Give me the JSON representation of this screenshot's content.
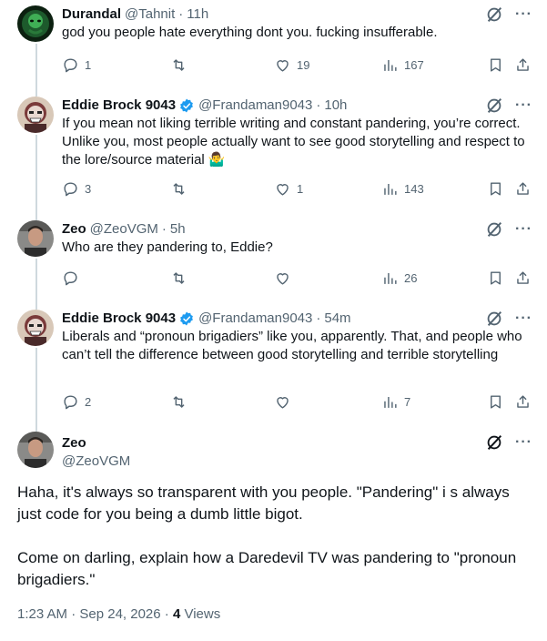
{
  "replies": [
    {
      "name": "Durandal",
      "handle": "@Tahnit",
      "time": "11h",
      "verified": false,
      "text": "god you people hate everything dont you. fucking insufferable.",
      "reply_count": "1",
      "retweet_count": "",
      "like_count": "19",
      "view_count": "167"
    },
    {
      "name": "Eddie Brock 9043",
      "handle": "@Frandaman9043",
      "time": "10h",
      "verified": true,
      "text": "If you mean not liking terrible writing and constant pandering, you’re correct. Unlike you, most people actually want to see good storytelling and respect to the lore/source material 🤷‍♂️",
      "reply_count": "3",
      "retweet_count": "",
      "like_count": "1",
      "view_count": "143"
    },
    {
      "name": "Zeo",
      "handle": "@ZeoVGM",
      "time": "5h",
      "verified": false,
      "text": "Who are they pandering to, Eddie?",
      "reply_count": "",
      "retweet_count": "",
      "like_count": "",
      "view_count": "26"
    },
    {
      "name": "Eddie Brock 9043",
      "handle": "@Frandaman9043",
      "time": "54m",
      "verified": true,
      "text": "Liberals and “pronoun brigadiers” like you, apparently. That, and people who can’t tell the difference between good storytelling and terrible storytelling",
      "reply_count": "2",
      "retweet_count": "",
      "like_count": "",
      "view_count": "7"
    }
  ],
  "focus": {
    "name": "Zeo",
    "handle": "@ZeoVGM",
    "paragraph1": "Haha, it's always so transparent with you people. \"Pandering\" i s always just code for you being a dumb little bigot.",
    "paragraph2": "Come on darling, explain how a Daredevil TV was pandering to \"pronoun brigadiers.\"",
    "timestamp": "1:23 AM · Sep 24, 2026 · ",
    "views_count": "4",
    "views_label": " Views"
  },
  "icons": {
    "more": "more-dots-icon",
    "grok": "grok-icon",
    "reply": "reply-icon",
    "retweet": "retweet-icon",
    "like": "like-icon",
    "views": "views-icon",
    "bookmark": "bookmark-icon",
    "share": "share-icon",
    "verified": "verified-badge-icon"
  },
  "colors": {
    "text": "#0f1419",
    "secondary": "#536471",
    "verified": "#1d9bf0",
    "thread_line": "#cfd9de"
  }
}
